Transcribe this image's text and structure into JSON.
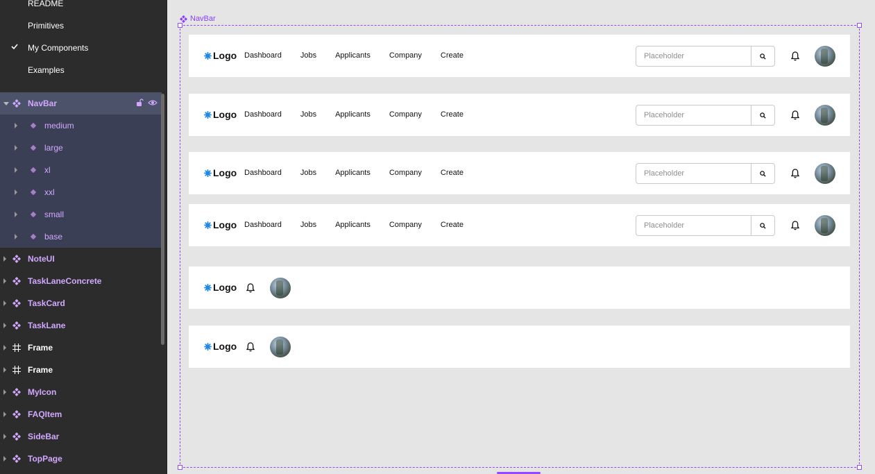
{
  "pages": [
    {
      "label": "README",
      "checked": false
    },
    {
      "label": "Primitives",
      "checked": false
    },
    {
      "label": "My Components",
      "checked": true
    },
    {
      "label": "Examples",
      "checked": false
    }
  ],
  "layers": {
    "selected": {
      "label": "NavBar"
    },
    "variants": [
      "medium",
      "large",
      "xl",
      "xxl",
      "small",
      "base"
    ],
    "others": [
      {
        "label": "NoteUI",
        "kind": "component"
      },
      {
        "label": "TaskLaneConcrete",
        "kind": "component"
      },
      {
        "label": "TaskCard",
        "kind": "component"
      },
      {
        "label": "TaskLane",
        "kind": "component"
      },
      {
        "label": "Frame",
        "kind": "frame"
      },
      {
        "label": "Frame",
        "kind": "frame"
      },
      {
        "label": "MyIcon",
        "kind": "component"
      },
      {
        "label": "FAQItem",
        "kind": "component"
      },
      {
        "label": "SideBar",
        "kind": "component"
      },
      {
        "label": "TopPage",
        "kind": "component"
      }
    ]
  },
  "canvas": {
    "frame_label": "NavBar",
    "navbar": {
      "logo": "Logo",
      "links": [
        "Dashboard",
        "Jobs",
        "Applicants",
        "Company",
        "Create"
      ],
      "search_placeholder": "Placeholder"
    }
  },
  "colors": {
    "accent": "#9747ff",
    "component_text": "#d2a8ff",
    "logo_star": "#1e88e5",
    "panel_bg": "#2c2c2c",
    "canvas_bg": "#e5e5e5"
  }
}
